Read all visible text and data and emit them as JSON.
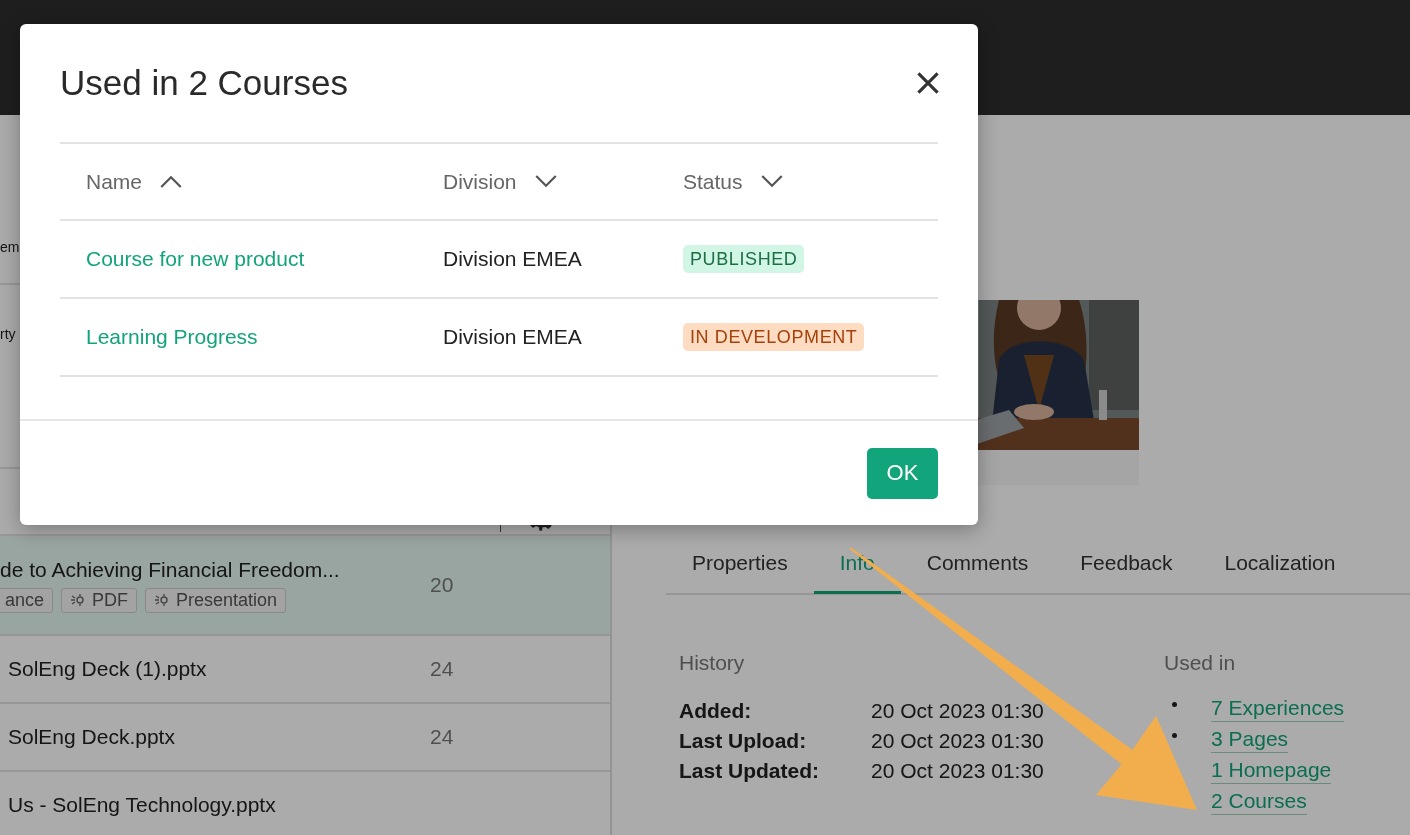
{
  "background": {
    "list": {
      "fragments": [
        "em",
        "rty"
      ],
      "rows": [
        {
          "name": "de to Achieving Financial Freedom...",
          "tags": [
            {
              "label": "ance",
              "icon": false
            },
            {
              "label": "PDF",
              "icon": true
            },
            {
              "label": "Presentation",
              "icon": true
            }
          ],
          "date": "20",
          "selected": true
        },
        {
          "name": "SolEng Deck (1).pptx",
          "date": "24",
          "selected": false
        },
        {
          "name": "SolEng Deck.pptx",
          "date": "24",
          "selected": false
        },
        {
          "name": "Us - SolEng Technology.pptx",
          "selected": false
        }
      ]
    },
    "detail": {
      "tabs": [
        {
          "label": "Properties",
          "selected": false
        },
        {
          "label": "Info",
          "selected": true
        },
        {
          "label": "Comments",
          "selected": false
        },
        {
          "label": "Feedback",
          "selected": false
        },
        {
          "label": "Localization",
          "selected": false
        }
      ],
      "history": {
        "title": "History",
        "items": [
          {
            "label": "Added:",
            "value": "20 Oct 2023 01:30"
          },
          {
            "label": "Last Upload:",
            "value": "20 Oct 2023 01:30"
          },
          {
            "label": "Last Updated:",
            "value": "20 Oct 2023 01:30"
          }
        ]
      },
      "used_in": {
        "title": "Used in",
        "links": [
          "7 Experiences",
          "3 Pages",
          "1 Homepage",
          "2 Courses"
        ]
      }
    }
  },
  "dialog": {
    "title": "Used in 2 Courses",
    "columns": [
      {
        "label": "Name",
        "ascending": true
      },
      {
        "label": "Division",
        "ascending": false
      },
      {
        "label": "Status",
        "ascending": false
      }
    ],
    "rows": [
      {
        "name": "Course for new product",
        "division": "Division EMEA",
        "status": {
          "label": "PUBLISHED",
          "kind": "published"
        }
      },
      {
        "name": "Learning Progress",
        "division": "Division EMEA",
        "status": {
          "label": "IN DEVELOPMENT",
          "kind": "development"
        }
      }
    ],
    "ok_button": "OK"
  }
}
